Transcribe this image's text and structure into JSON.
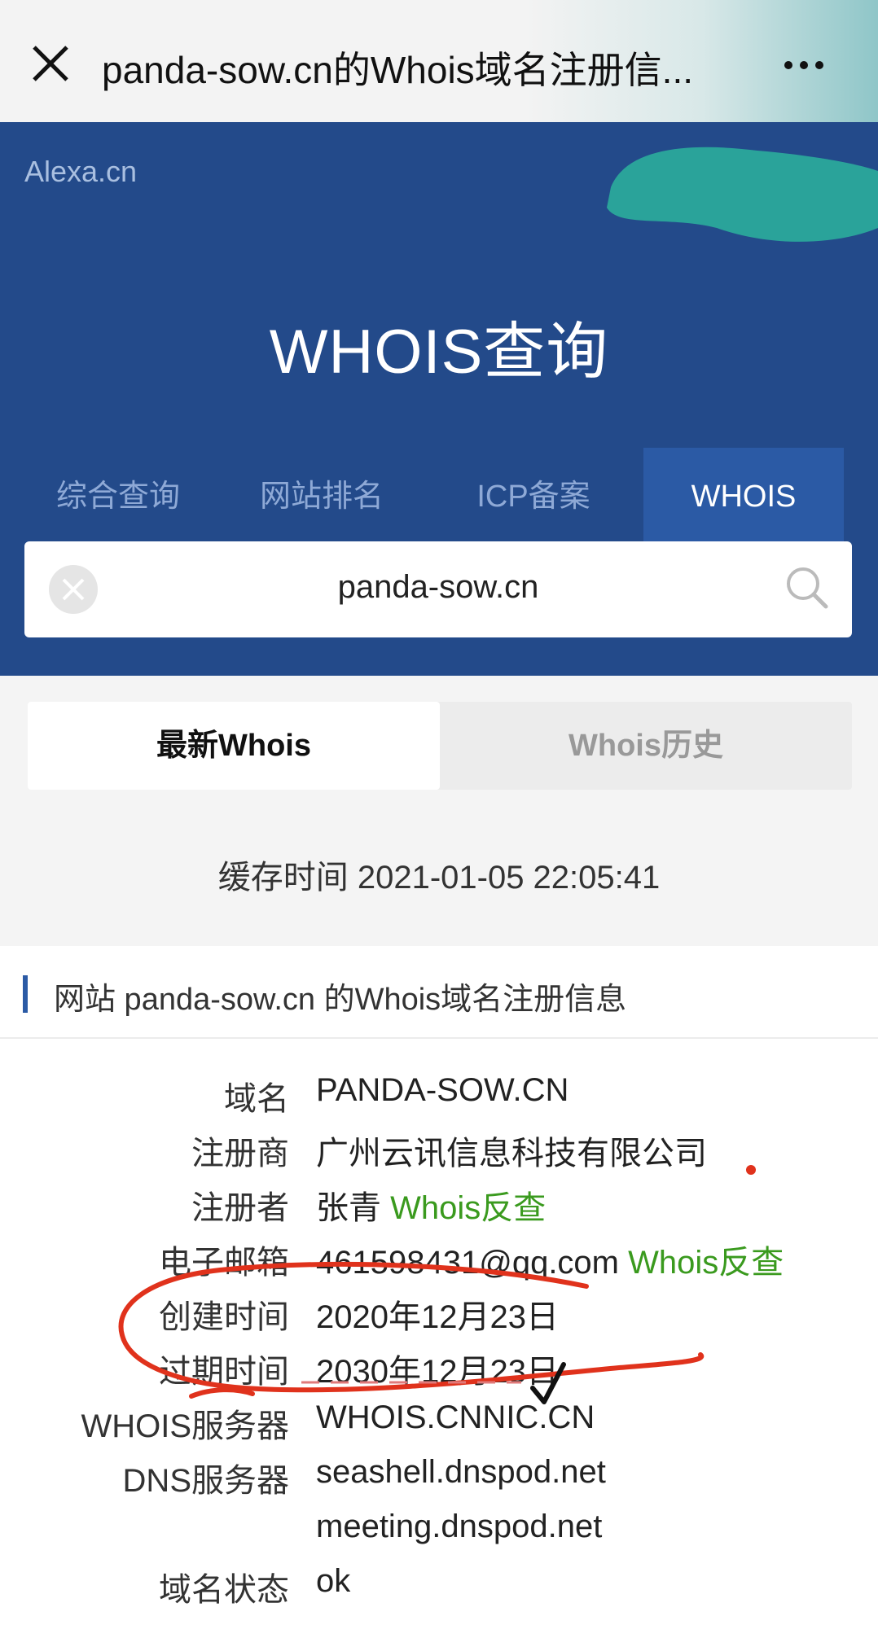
{
  "topbar": {
    "title": "panda-sow.cn的Whois域名注册信..."
  },
  "hero": {
    "brand": "Alexa.cn",
    "title": "WHOIS查询",
    "tabs": [
      {
        "label": "综合查询"
      },
      {
        "label": "网站排名"
      },
      {
        "label": "ICP备案"
      },
      {
        "label": "WHOIS"
      }
    ]
  },
  "search": {
    "value": "panda-sow.cn"
  },
  "segments": {
    "latest": "最新Whois",
    "history": "Whois历史"
  },
  "cache": {
    "text": "缓存时间 2021-01-05 22:05:41"
  },
  "section": {
    "title": "网站 panda-sow.cn 的Whois域名注册信息"
  },
  "whois": {
    "domain_label": "域名",
    "domain_value": "PANDA-SOW.CN",
    "registrar_label": "注册商",
    "registrar_value": "广州云讯信息科技有限公司",
    "registrant_label": "注册者",
    "registrant_value": "张青",
    "registrant_link": "Whois反查",
    "email_label": "电子邮箱",
    "email_value": "461598431@qq.com",
    "email_link": "Whois反查",
    "created_label": "创建时间",
    "created_value": "2020年12月23日",
    "expires_label": "过期时间",
    "expires_value": "2030年12月23日",
    "server_label": "WHOIS服务器",
    "server_value": "WHOIS.CNNIC.CN",
    "dns_label": "DNS服务器",
    "dns_values": [
      "seashell.dnspod.net",
      "meeting.dnspod.net"
    ],
    "status_label": "域名状态",
    "status_value": "ok"
  },
  "colors": {
    "hero_bg": "#234a8a",
    "active_tab": "#2b5aa5",
    "link_green": "#3a9a1e",
    "annotation_red": "#e0321c"
  }
}
